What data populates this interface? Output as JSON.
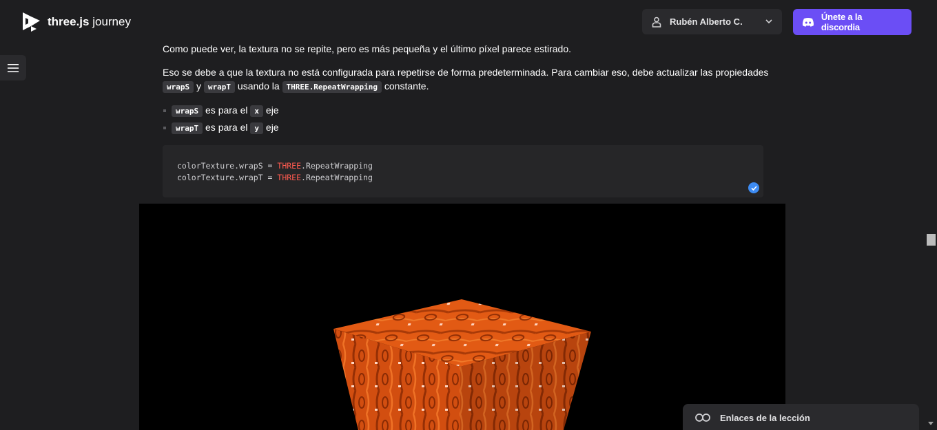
{
  "header": {
    "logo": {
      "brand": "three.js",
      "suffix": " journey"
    },
    "user": {
      "name": "Rubén Alberto C."
    },
    "discord": {
      "label": "Únete a la discordia"
    }
  },
  "content": {
    "p1": "Como puede ver, la textura no se repite, pero es más pequeña y el último píxel parece estirado.",
    "p2": {
      "before": "Eso se debe a que la textura no está configurada para repetirse de forma predeterminada. Para cambiar eso, debe actualizar las propiedades ",
      "code1": "wrapS",
      "mid1": " y ",
      "code2": "wrapT",
      "mid2": " usando la ",
      "code3": "THREE.RepeatWrapping",
      "after": " constante."
    },
    "bullets": [
      {
        "code": "wrapS",
        "text": " es para el ",
        "axis": "x",
        "tail": " eje"
      },
      {
        "code": "wrapT",
        "text": " es para el ",
        "axis": "y",
        "tail": " eje"
      }
    ]
  },
  "code_block": {
    "line1": {
      "prefix": "colorTexture.wrapS = ",
      "kw": "THREE",
      "suffix": ".RepeatWrapping"
    },
    "line2": {
      "prefix": "colorTexture.wrapT = ",
      "kw": "THREE",
      "suffix": ".RepeatWrapping"
    }
  },
  "lesson_links": {
    "label": "Enlaces de la lección"
  },
  "colors": {
    "accent": "#6b4ef5",
    "code_keyword": "#ff5a4f",
    "cube": "#e25a14"
  }
}
